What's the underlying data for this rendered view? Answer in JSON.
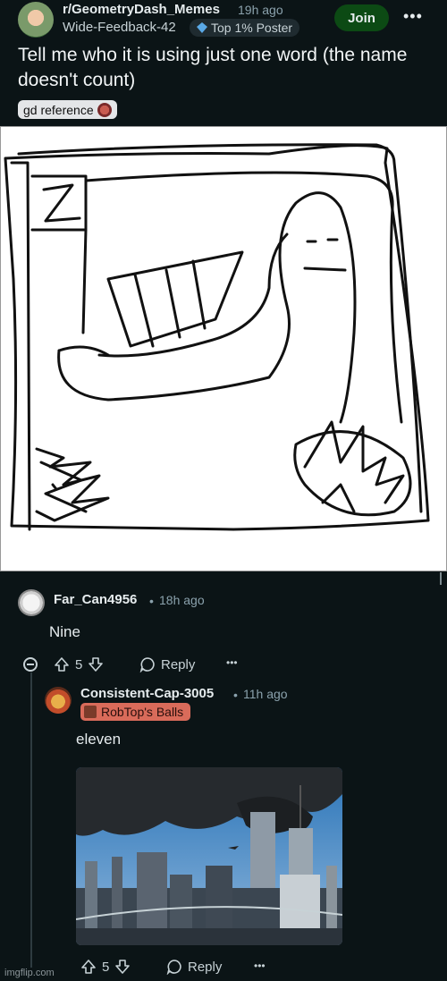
{
  "post": {
    "subreddit": "r/GeometryDash_Memes",
    "time": "19h ago",
    "author": "Wide-Feedback-42",
    "author_flair": "Top 1% Poster",
    "join_label": "Join",
    "more_label": "•••",
    "title": "Tell me who it is using just one word (the name doesn't count)",
    "post_flair": "gd reference"
  },
  "comments": [
    {
      "author": "Far_Can4956",
      "time": "18h ago",
      "body": "Nine",
      "votes": "5",
      "reply_label": "Reply",
      "more_label": "•••"
    },
    {
      "author": "Consistent-Cap-3005",
      "time": "11h ago",
      "flair": "RobTop's Balls",
      "body": "eleven",
      "votes": "5",
      "reply_label": "Reply",
      "more_label": "•••"
    }
  ],
  "separator": "•",
  "watermark": "imgflip.com",
  "colors": {
    "background": "#0b1416",
    "join_button": "#0c4a14",
    "user_flair": "#d96b5a"
  }
}
